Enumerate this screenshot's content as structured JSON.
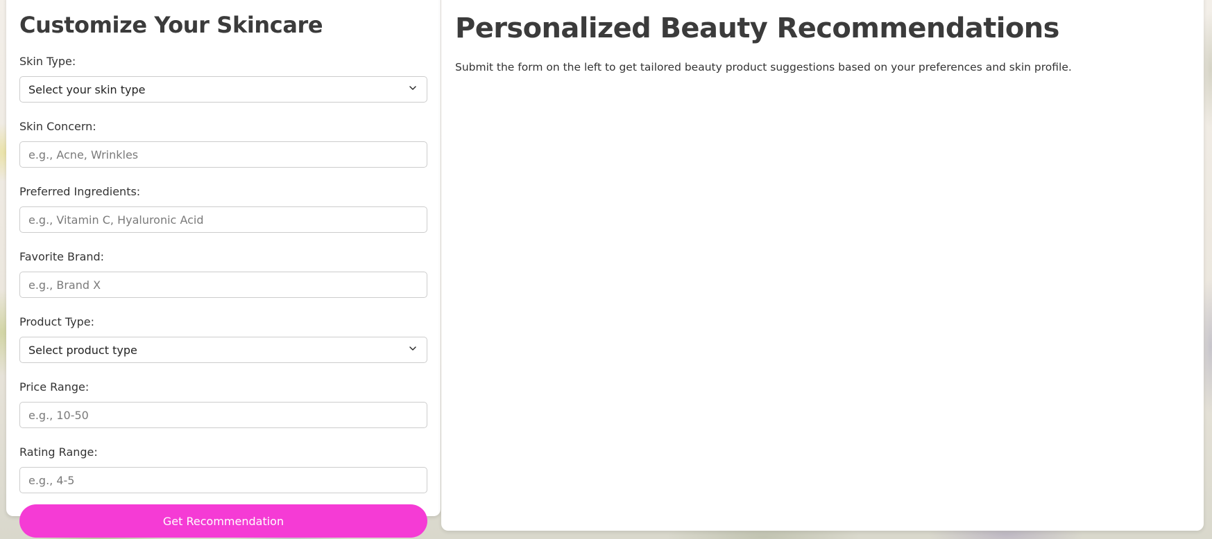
{
  "form": {
    "title": "Customize Your Skincare",
    "skin_type": {
      "label": "Skin Type:",
      "selected": "Select your skin type"
    },
    "skin_concern": {
      "label": "Skin Concern:",
      "placeholder": "e.g., Acne, Wrinkles",
      "value": ""
    },
    "preferred_ingredients": {
      "label": "Preferred Ingredients:",
      "placeholder": "e.g., Vitamin C, Hyaluronic Acid",
      "value": ""
    },
    "favorite_brand": {
      "label": "Favorite Brand:",
      "placeholder": "e.g., Brand X",
      "value": ""
    },
    "product_type": {
      "label": "Product Type:",
      "selected": "Select product type"
    },
    "price_range": {
      "label": "Price Range:",
      "placeholder": "e.g., 10-50",
      "value": ""
    },
    "rating_range": {
      "label": "Rating Range:",
      "placeholder": "e.g., 4-5",
      "value": ""
    },
    "submit_label": "Get Recommendation"
  },
  "recommendations": {
    "title": "Personalized Beauty Recommendations",
    "message": "Submit the form on the left to get tailored beauty product suggestions based on your preferences and skin profile."
  },
  "icons": {
    "select_chevron": "chevron-down-icon"
  },
  "colors": {
    "accent": "#f53bd5",
    "card_background": "#ffffff",
    "heading_text": "#3b3b3b",
    "input_border": "#cccccc"
  }
}
